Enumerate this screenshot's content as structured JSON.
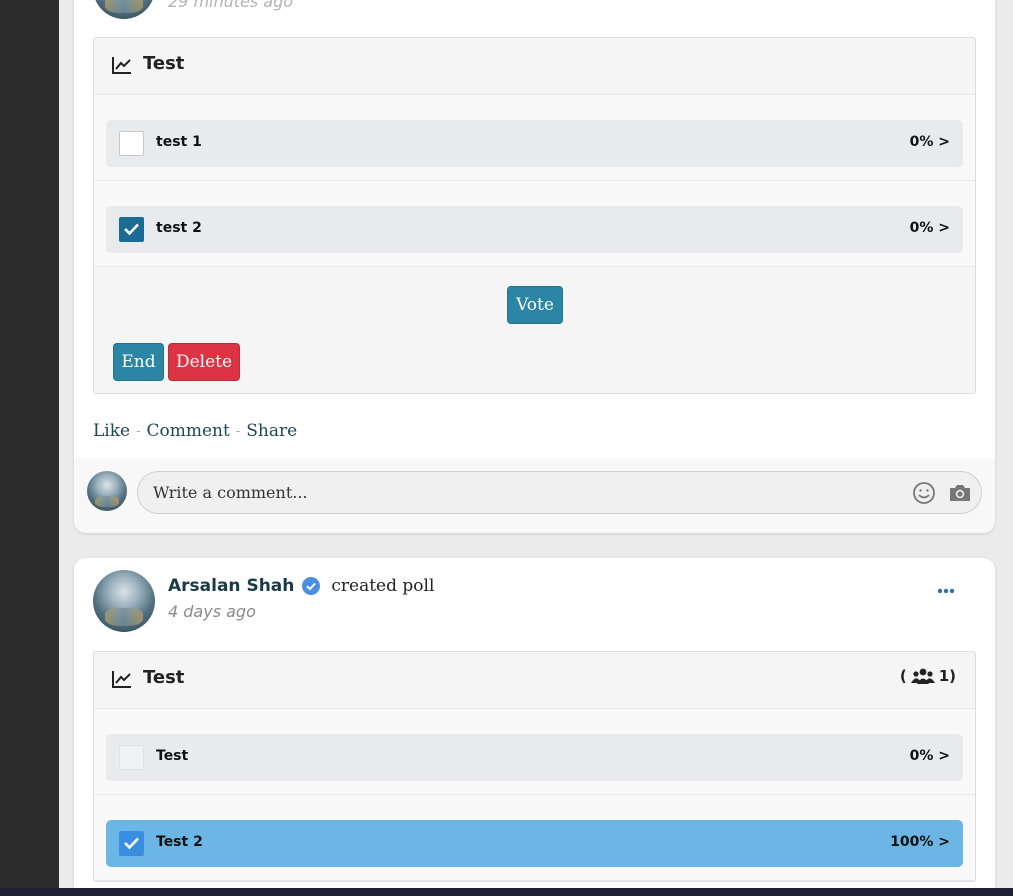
{
  "post1": {
    "timestamp": "29 minutes ago",
    "poll": {
      "title": "Test",
      "options": [
        {
          "label": "test 1",
          "percent": "0% >",
          "checked": false
        },
        {
          "label": "test 2",
          "percent": "0% >",
          "checked": true
        }
      ],
      "vote_label": "Vote",
      "end_label": "End",
      "delete_label": "Delete"
    },
    "actions": {
      "like": "Like",
      "comment": "Comment",
      "share": "Share",
      "sep": "-"
    },
    "comment_placeholder": "Write a comment..."
  },
  "post2": {
    "author": "Arsalan Shah",
    "action": "created poll",
    "timestamp": "4 days ago",
    "poll": {
      "title": "Test",
      "voters_open": "(",
      "voters_count": "1)",
      "options": [
        {
          "label": "Test",
          "percent": "0% >",
          "checked": false
        },
        {
          "label": "Test 2",
          "percent": "100% >",
          "checked": true
        }
      ]
    }
  },
  "colors": {
    "accent": "#2a86a4",
    "danger": "#dc3445",
    "selected_option": "#6cb6e6",
    "verified": "#4a90e2"
  },
  "icons": [
    "chart-line-icon",
    "check-icon",
    "people-icon",
    "verified-icon",
    "more-icon",
    "smile-icon",
    "camera-icon"
  ]
}
